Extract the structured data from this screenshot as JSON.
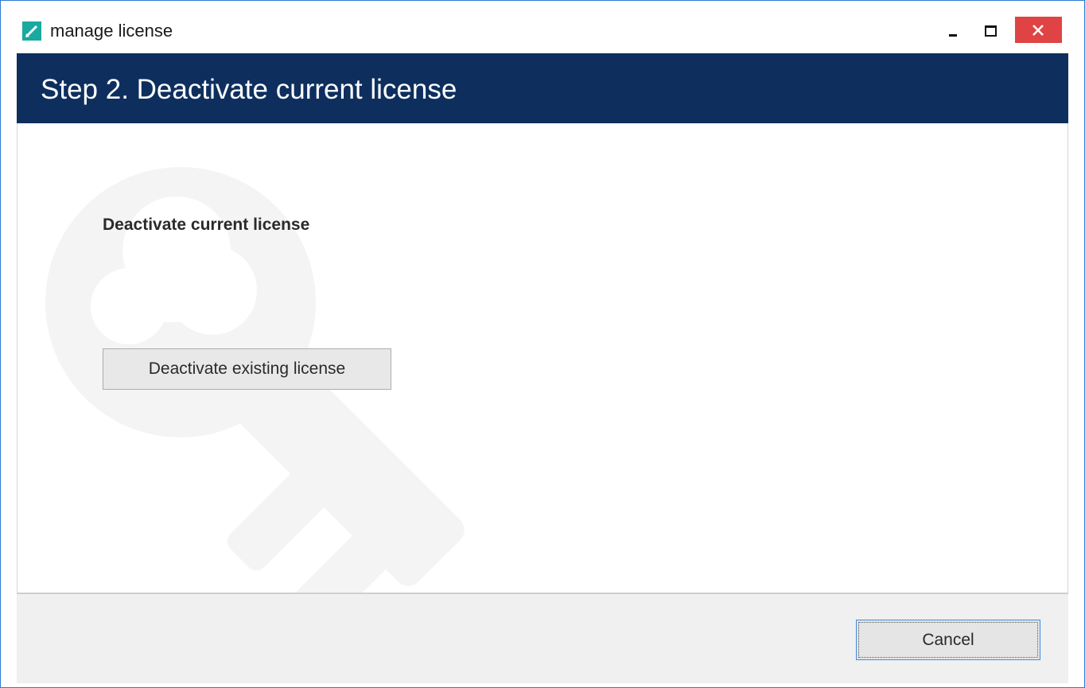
{
  "window": {
    "title": "manage license",
    "app_icon": "license-pencil-icon",
    "controls": [
      "minimize-icon",
      "maximize-icon",
      "close-icon"
    ],
    "close_color": "#e04343"
  },
  "header": {
    "title": "Step 2. Deactivate current license",
    "background": "#0e2f5e"
  },
  "main": {
    "section_title": "Deactivate current license",
    "deactivate_button_label": "Deactivate existing license",
    "watermark_icon": "key-icon"
  },
  "footer": {
    "cancel_label": "Cancel"
  }
}
